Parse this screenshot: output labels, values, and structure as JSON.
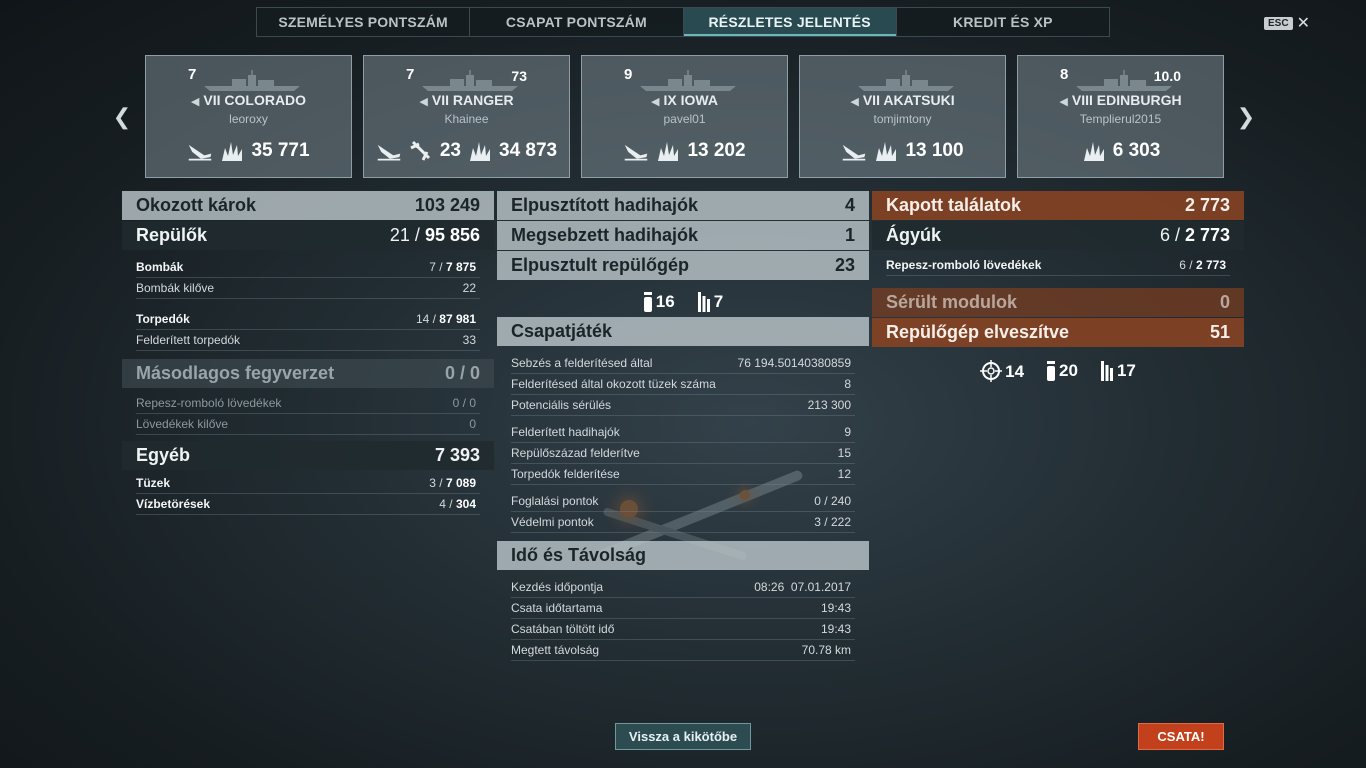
{
  "tabs": [
    {
      "label": "SZEMÉLYES PONTSZÁM"
    },
    {
      "label": "CSAPAT PONTSZÁM"
    },
    {
      "label": "RÉSZLETES JELENTÉS"
    },
    {
      "label": "KREDIT ÉS XP"
    }
  ],
  "esc_label": "ESC",
  "players": [
    {
      "tier": "7",
      "rank": "",
      "ship": "VII COLORADO",
      "player": "leoroxy",
      "stats": [
        "",
        "35 771"
      ],
      "icons": [
        "plane-down-icon",
        "explosion-icon"
      ]
    },
    {
      "tier": "7",
      "rank": "73",
      "ship": "VII RANGER",
      "player": "Khainee",
      "stats": [
        "",
        "23",
        "34 873"
      ],
      "icons": [
        "plane-down-icon",
        "plane-shot-icon",
        "explosion-icon"
      ]
    },
    {
      "tier": "9",
      "rank": "",
      "ship": "IX IOWA",
      "player": "pavel01",
      "stats": [
        "",
        "13 202"
      ],
      "icons": [
        "plane-down-icon",
        "explosion-icon"
      ]
    },
    {
      "tier": "",
      "rank": "",
      "ship": "VII AKATSUKI",
      "player": "tomjimtony",
      "stats": [
        "",
        "13 100"
      ],
      "icons": [
        "plane-down-icon",
        "explosion-icon"
      ]
    },
    {
      "tier": "8",
      "rank": "10.0",
      "ship": "VIII EDINBURGH",
      "player": "Templierul2015",
      "stats": [
        "6 303"
      ],
      "icons": [
        "explosion-icon"
      ]
    }
  ],
  "left": {
    "damage": {
      "label": "Okozott károk",
      "value": "103 249"
    },
    "aircraft": {
      "label": "Repülők",
      "value_a": "21 / ",
      "value_b": "95 856"
    },
    "bombs": {
      "label": "Bombák",
      "value_a": "7 / ",
      "value_b": "7 875"
    },
    "bombs_fired": {
      "label": "Bombák kilőve",
      "value": "22"
    },
    "torpedoes": {
      "label": "Torpedók",
      "value_a": "14 / ",
      "value_b": "87 981"
    },
    "torpedoes_spotted": {
      "label": "Felderített torpedók",
      "value": "33"
    },
    "secondary": {
      "label": "Másodlagos fegyverzet",
      "value": "0 / 0"
    },
    "he_shells": {
      "label": "Repesz-romboló lövedékek",
      "value": "0 / 0"
    },
    "shells_fired": {
      "label": "Lövedékek kilőve",
      "value": "0"
    },
    "other": {
      "label": "Egyéb",
      "value": "7 393"
    },
    "fires": {
      "label": "Tüzek",
      "value_a": "3 / ",
      "value_b": "7 089"
    },
    "floods": {
      "label": "Vízbetörések",
      "value_a": "4 / ",
      "value_b": "304"
    }
  },
  "middle": {
    "destroyed": {
      "label": "Elpusztított hadihajók",
      "value": "4"
    },
    "damaged": {
      "label": "Megsebzett hadihajók",
      "value": "1"
    },
    "planes_destroyed": {
      "label": "Elpusztult repülőgép",
      "value": "23"
    },
    "icon_stats": [
      {
        "icon": "bomb-icon",
        "value": "16"
      },
      {
        "icon": "torpedo-icon",
        "value": "7"
      }
    ],
    "teamplay": {
      "label": "Csapatjáték"
    },
    "spot_damage": {
      "label": "Sebzés a felderítésed által",
      "value": "76 194.50140380859"
    },
    "spot_fires": {
      "label": "Felderítésed által okozott tüzek száma",
      "value": "8"
    },
    "potential": {
      "label": "Potenciális sérülés",
      "value": "213 300"
    },
    "ships_spotted": {
      "label": "Felderített hadihajók",
      "value": "9"
    },
    "squadrons_spotted": {
      "label": "Repülőszázad felderítve",
      "value": "15"
    },
    "torps_spotted": {
      "label": "Torpedók felderítése",
      "value": "12"
    },
    "capture": {
      "label": "Foglalási pontok",
      "value": "0 / 240"
    },
    "defense": {
      "label": "Védelmi pontok",
      "value": "3 / 222"
    },
    "time": {
      "label": "Idő és Távolság"
    },
    "start": {
      "label": "Kezdés időpontja",
      "value": "08:26  07.01.2017"
    },
    "duration": {
      "label": "Csata időtartama",
      "value": "19:43"
    },
    "time_in_battle": {
      "label": "Csatában töltött idő",
      "value": "19:43"
    },
    "distance": {
      "label": "Megtett távolság",
      "value": "70.78 km"
    }
  },
  "right": {
    "hits": {
      "label": "Kapott találatok",
      "value": "2 773"
    },
    "guns": {
      "label": "Ágyúk",
      "value_a": "6 / ",
      "value_b": "2 773"
    },
    "he": {
      "label": "Repesz-romboló lövedékek",
      "value_a": "6 / ",
      "value_b": "2 773"
    },
    "modules": {
      "label": "Sérült modulok",
      "value": "0"
    },
    "planes_lost": {
      "label": "Repülőgép elveszítve",
      "value": "51"
    },
    "icon_stats": [
      {
        "icon": "crosshair-icon",
        "value": "14"
      },
      {
        "icon": "bomb-icon",
        "value": "20"
      },
      {
        "icon": "torpedo-icon",
        "value": "17"
      }
    ]
  },
  "buttons": {
    "back": "Vissza a kikötőbe",
    "battle": "CSATA!"
  }
}
